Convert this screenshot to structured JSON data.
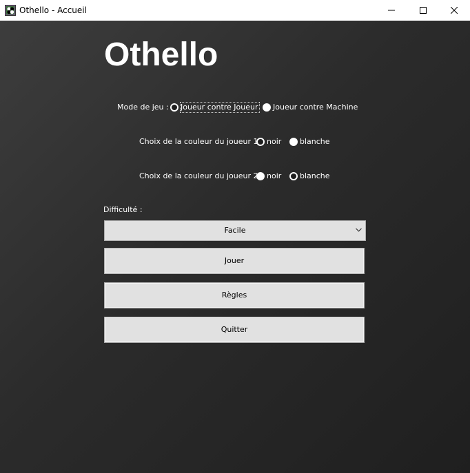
{
  "window": {
    "title": "Othello - Accueil"
  },
  "header": {
    "title": "Othello"
  },
  "game_mode": {
    "label": "Mode de jeu :",
    "options": [
      {
        "label": "Joueur contre Joueur",
        "checked": true
      },
      {
        "label": "Joueur contre Machine",
        "checked": false
      }
    ]
  },
  "player1_color": {
    "label": "Choix de la couleur du joueur 1 :",
    "options": [
      {
        "label": "noir",
        "checked": true
      },
      {
        "label": "blanche",
        "checked": false
      }
    ]
  },
  "player2_color": {
    "label": "Choix de la couleur du joueur 2 :",
    "options": [
      {
        "label": "noir",
        "checked": false
      },
      {
        "label": "blanche",
        "checked": true
      }
    ]
  },
  "difficulty": {
    "label": "Difficulté :",
    "selected": "Facile"
  },
  "buttons": {
    "play": "Jouer",
    "rules": "Règles",
    "quit": "Quitter"
  },
  "icons": {
    "app": "othello-app-icon",
    "minimize": "minimize-icon",
    "maximize": "maximize-icon",
    "close": "close-icon",
    "dropdown": "chevron-down-icon"
  },
  "colors": {
    "background_dark": "#2b2b2b",
    "button_face": "#e1e1e1",
    "text_light": "#ffffff"
  }
}
